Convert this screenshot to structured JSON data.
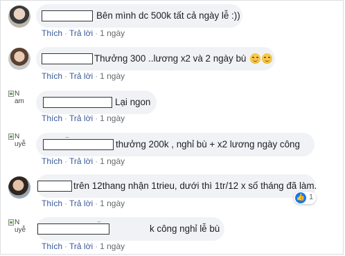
{
  "comments": [
    {
      "text": "Bên mình dc 500k tất cả ngày lễ :))",
      "actions": {
        "like": "Thích",
        "reply": "Trả lời",
        "time": "1 ngày"
      }
    },
    {
      "text": "Thưởng 300 ..lương x2 và 2 ngày bù",
      "emoji": [
        "smiling-face-icon",
        "smiling-face-icon"
      ],
      "actions": {
        "like": "Thích",
        "reply": "Trả lời",
        "time": "1 ngày"
      }
    },
    {
      "avatar_alt": "N\nam",
      "text": "Lại ngon",
      "actions": {
        "like": "Thích",
        "reply": "Trả lời",
        "time": "1 ngày"
      }
    },
    {
      "avatar_alt": "N\nuyễ",
      "name_fragment": "~",
      "text": "thưởng 200k , nghỉ bù + x2 lương ngày công",
      "actions": {
        "like": "Thích",
        "reply": "Trả lời",
        "time": "1 ngày"
      }
    },
    {
      "text": "trên 12thang nhận 1trieu, dưới thì 1tr/12 x số tháng đã làm.",
      "reaction": {
        "icon": "thumbs-up-icon",
        "count": "1"
      },
      "actions": {
        "like": "Thích",
        "reply": "Trả lời",
        "time": "1 ngày"
      }
    },
    {
      "avatar_alt": "N\nuyễ",
      "name_fragment": "~",
      "text": "k công nghỉ lễ bù",
      "actions": {
        "like": "Thích",
        "reply": "Trả lời",
        "time": "1 ngày"
      }
    }
  ]
}
